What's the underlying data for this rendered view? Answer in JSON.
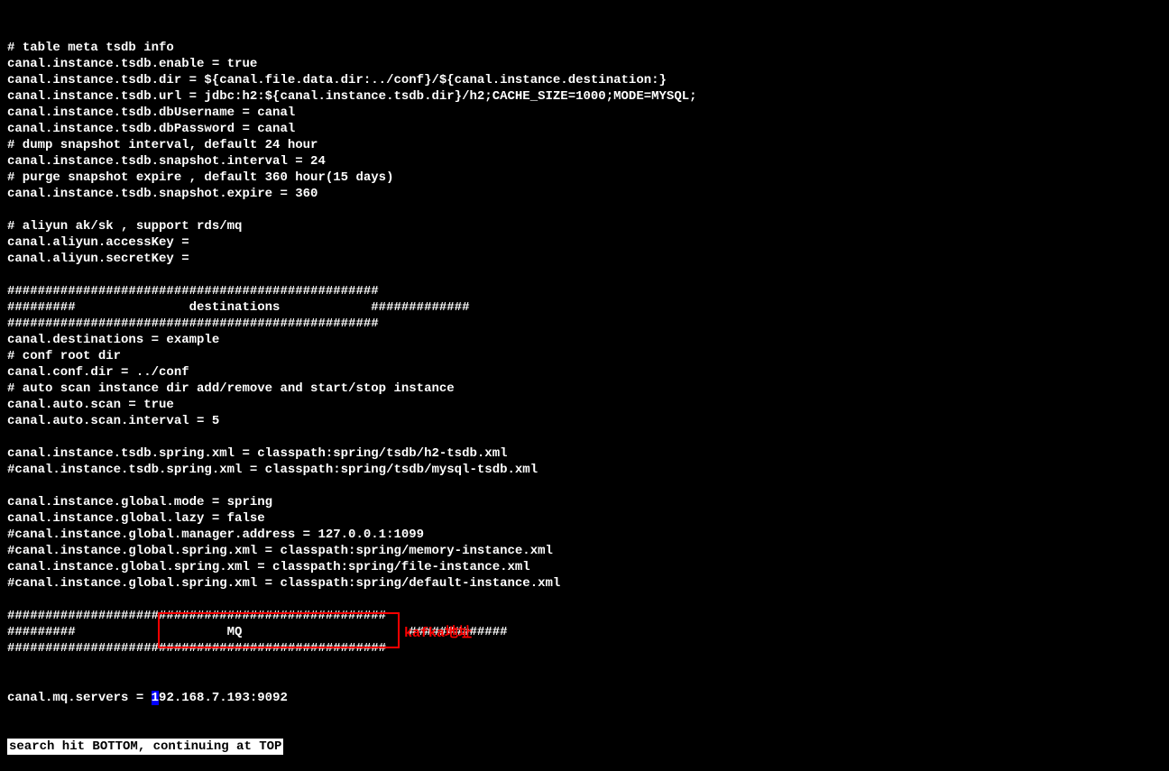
{
  "lines": [
    "# table meta tsdb info",
    "canal.instance.tsdb.enable = true",
    "canal.instance.tsdb.dir = ${canal.file.data.dir:../conf}/${canal.instance.destination:}",
    "canal.instance.tsdb.url = jdbc:h2:${canal.instance.tsdb.dir}/h2;CACHE_SIZE=1000;MODE=MYSQL;",
    "canal.instance.tsdb.dbUsername = canal",
    "canal.instance.tsdb.dbPassword = canal",
    "# dump snapshot interval, default 24 hour",
    "canal.instance.tsdb.snapshot.interval = 24",
    "# purge snapshot expire , default 360 hour(15 days)",
    "canal.instance.tsdb.snapshot.expire = 360",
    "",
    "# aliyun ak/sk , support rds/mq",
    "canal.aliyun.accessKey =",
    "canal.aliyun.secretKey =",
    "",
    "#################################################",
    "#########               destinations            #############",
    "#################################################",
    "canal.destinations = example",
    "# conf root dir",
    "canal.conf.dir = ../conf",
    "# auto scan instance dir add/remove and start/stop instance",
    "canal.auto.scan = true",
    "canal.auto.scan.interval = 5",
    "",
    "canal.instance.tsdb.spring.xml = classpath:spring/tsdb/h2-tsdb.xml",
    "#canal.instance.tsdb.spring.xml = classpath:spring/tsdb/mysql-tsdb.xml",
    "",
    "canal.instance.global.mode = spring",
    "canal.instance.global.lazy = false",
    "#canal.instance.global.manager.address = 127.0.0.1:1099",
    "#canal.instance.global.spring.xml = classpath:spring/memory-instance.xml",
    "canal.instance.global.spring.xml = classpath:spring/file-instance.xml",
    "#canal.instance.global.spring.xml = classpath:spring/default-instance.xml",
    "",
    "##################################################",
    "#########                    MQ                      #############",
    "##################################################"
  ],
  "mq_line": {
    "prefix": "canal.mq.servers = ",
    "cursor_char": "1",
    "suffix": "92.168.7.193:9092"
  },
  "status": "search hit BOTTOM, continuing at TOP",
  "annotation": {
    "label": "kafka地址"
  }
}
